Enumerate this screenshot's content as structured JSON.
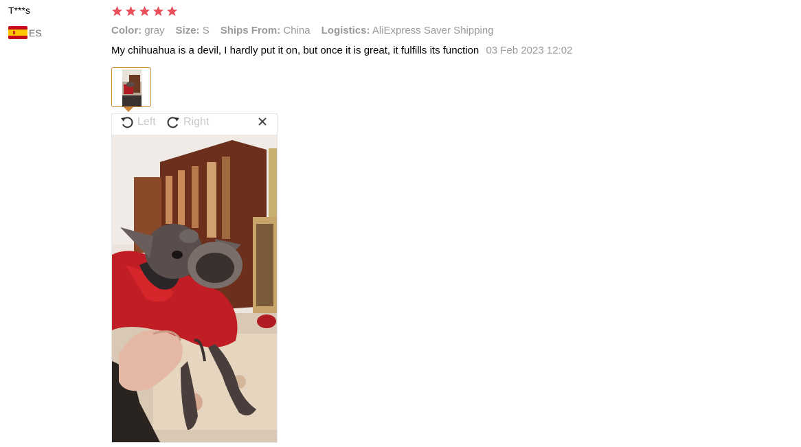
{
  "reviewer": {
    "name": "T***s",
    "country_code": "ES",
    "flag_icon": "spain-flag-icon"
  },
  "review": {
    "stars": 5,
    "star_color": "#e8505b",
    "properties": [
      {
        "key": "Color:",
        "value": "gray"
      },
      {
        "key": "Size:",
        "value": "S"
      },
      {
        "key": "Ships From:",
        "value": "China"
      },
      {
        "key": "Logistics:",
        "value": "AliExpress Saver Shipping"
      }
    ],
    "text": "My chihuahua is a devil, I hardly put it on, but once it is great, it fulfills its function",
    "date": "03 Feb 2023 12:02"
  },
  "viewer": {
    "rotate_left_label": "Left",
    "rotate_right_label": "Right",
    "close_icon": "close-icon",
    "accent_color": "#c9883a"
  }
}
